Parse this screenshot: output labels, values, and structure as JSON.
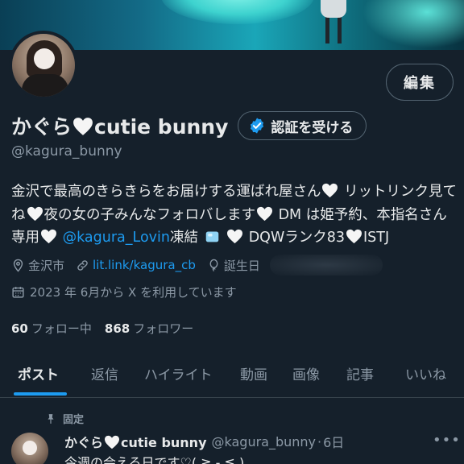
{
  "profile": {
    "display_name": "かぐら🤍cutie bunny",
    "display_name_text": "かぐら",
    "display_name_suffix": "cutie bunny",
    "handle": "@kagura_bunny",
    "edit_label": "編集",
    "verify_label": "認証を受ける",
    "bio": {
      "seg1": "金沢で最高のきらきらをお届けする運ばれ屋さん",
      "seg2": " リットリンク見てね",
      "seg3": "夜の女の子みんなフォロバします",
      "seg4": " DM は姫予約、本指名さん専用",
      "mention": "@kagura_Lovin",
      "seg5": "凍結",
      "seg6": " DQWランク83",
      "seg7": "ISTJ"
    },
    "location": "金沢市",
    "website": "lit.link/kagura_cb",
    "birthday_label": "誕生日",
    "joined": "2023 年 6月から X を利用しています",
    "following_count": "60",
    "following_label": "フォロー中",
    "followers_count": "868",
    "followers_label": "フォロワー"
  },
  "tabs": [
    {
      "label": "ポスト",
      "active": true
    },
    {
      "label": "返信",
      "active": false
    },
    {
      "label": "ハイライト",
      "active": false
    },
    {
      "label": "動画",
      "active": false
    },
    {
      "label": "画像",
      "active": false
    },
    {
      "label": "記事",
      "active": false
    },
    {
      "label": "いいね",
      "active": false
    }
  ],
  "pinned_post": {
    "pinned_label": "固定",
    "author_name": "かぐら",
    "author_suffix": "cutie bunny",
    "author_handle": "@kagura_bunny",
    "time": "6日",
    "text": "今週の会える日です♡( ≧ - ≦ )",
    "more_label": "•••"
  },
  "colors": {
    "background": "#15202b",
    "accent": "#1d9bf0",
    "text": "#e7e9ea",
    "muted": "#8b98a5",
    "border": "#536471"
  },
  "icons": [
    "heart-icon",
    "verified-badge-icon",
    "location-icon",
    "link-icon",
    "balloon-icon",
    "calendar-icon",
    "pin-icon",
    "ice-cube-emoji",
    "more-icon"
  ]
}
